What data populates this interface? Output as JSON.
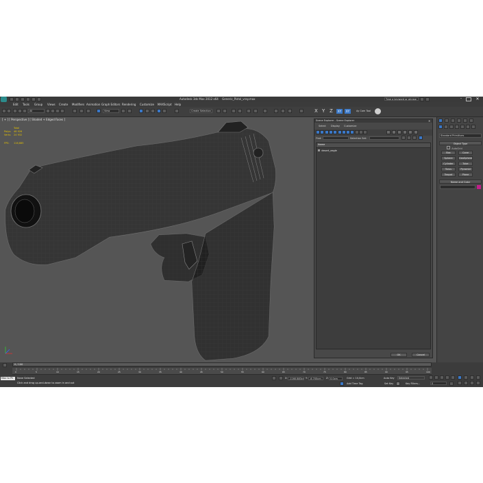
{
  "titlebar": {
    "app_title": "Autodesk 3ds Max  2012 x64",
    "file_name": "Generic_Pistol_vray.max",
    "search_placeholder": "Type a keyword or phrase"
  },
  "menu": [
    "Edit",
    "Tools",
    "Group",
    "Views",
    "Create",
    "Modifiers",
    "Animation",
    "Graph Editors",
    "Rendering",
    "Customize",
    "MAXScript",
    "Help"
  ],
  "toolbar": {
    "selection_filter": "All",
    "reference_coord": "View",
    "named_selection": "Create Selection Set",
    "axis_labels": [
      "X",
      "Y",
      "Z",
      "XY",
      "XY"
    ],
    "lens_label": "Ay Cam Tool"
  },
  "viewport": {
    "label": "[ + ] [ Perspective ] [ Shaded + Edged Faces ]",
    "stats_total": "Total",
    "stats_polys_label": "Polys:",
    "stats_polys": "48 926",
    "stats_verts_label": "Verts:",
    "stats_verts": "24 932",
    "fps_label": "FPS:",
    "fps": "116,685"
  },
  "scene_explorer": {
    "title": "Scene Explorer - Scene Explorer",
    "menu": [
      "Select",
      "Display",
      "Customize"
    ],
    "find_label": "Find:",
    "selection_set_label": "Selection Set:",
    "column_name": "Name",
    "objects": [
      "desert_eagle"
    ],
    "ok": "OK",
    "cancel": "Cancel"
  },
  "command_panel": {
    "category": "Standard Primitives",
    "object_type_title": "Object Type",
    "autogrid": "AutoGrid",
    "buttons": [
      "Box",
      "Cone",
      "Sphere",
      "GeoSphere",
      "Cylinder",
      "Tube",
      "Torus",
      "Pyramid",
      "Teapot",
      "Plane"
    ],
    "name_color_title": "Name and Color"
  },
  "timeline": {
    "frame_counter": "0 / 100",
    "ticks": [
      "0",
      "5",
      "10",
      "15",
      "20",
      "25",
      "30",
      "35",
      "40",
      "45",
      "50",
      "55",
      "60",
      "65",
      "70",
      "75",
      "80",
      "85",
      "90",
      "95",
      "100"
    ]
  },
  "status": {
    "script_label": "Max to Ph",
    "selection_text": "None Selected",
    "prompt_text": "Click and drag up-and-down to zoom in and out",
    "x_label": "X:",
    "x_value": "-1160,883cm",
    "y_label": "Y:",
    "y_value": "-6,705cm",
    "z_label": "Z:",
    "z_value": "0,0cm",
    "grid_text": "Grid = 10,0cm",
    "auto_key": "Auto Key",
    "set_key": "Set Key",
    "selected_dropdown": "Selected",
    "key_filters": "Key Filters...",
    "add_time_tag": "Add Time Tag",
    "frame_value": "0"
  },
  "colors": {
    "viewport_bg": "#555555",
    "wire": "#6e6e6e",
    "mesh_fill": "#1b1b1b",
    "accent_blue": "#3a78c8",
    "stat_yellow": "#e6c200",
    "swatch_magenta": "#c0208a"
  }
}
